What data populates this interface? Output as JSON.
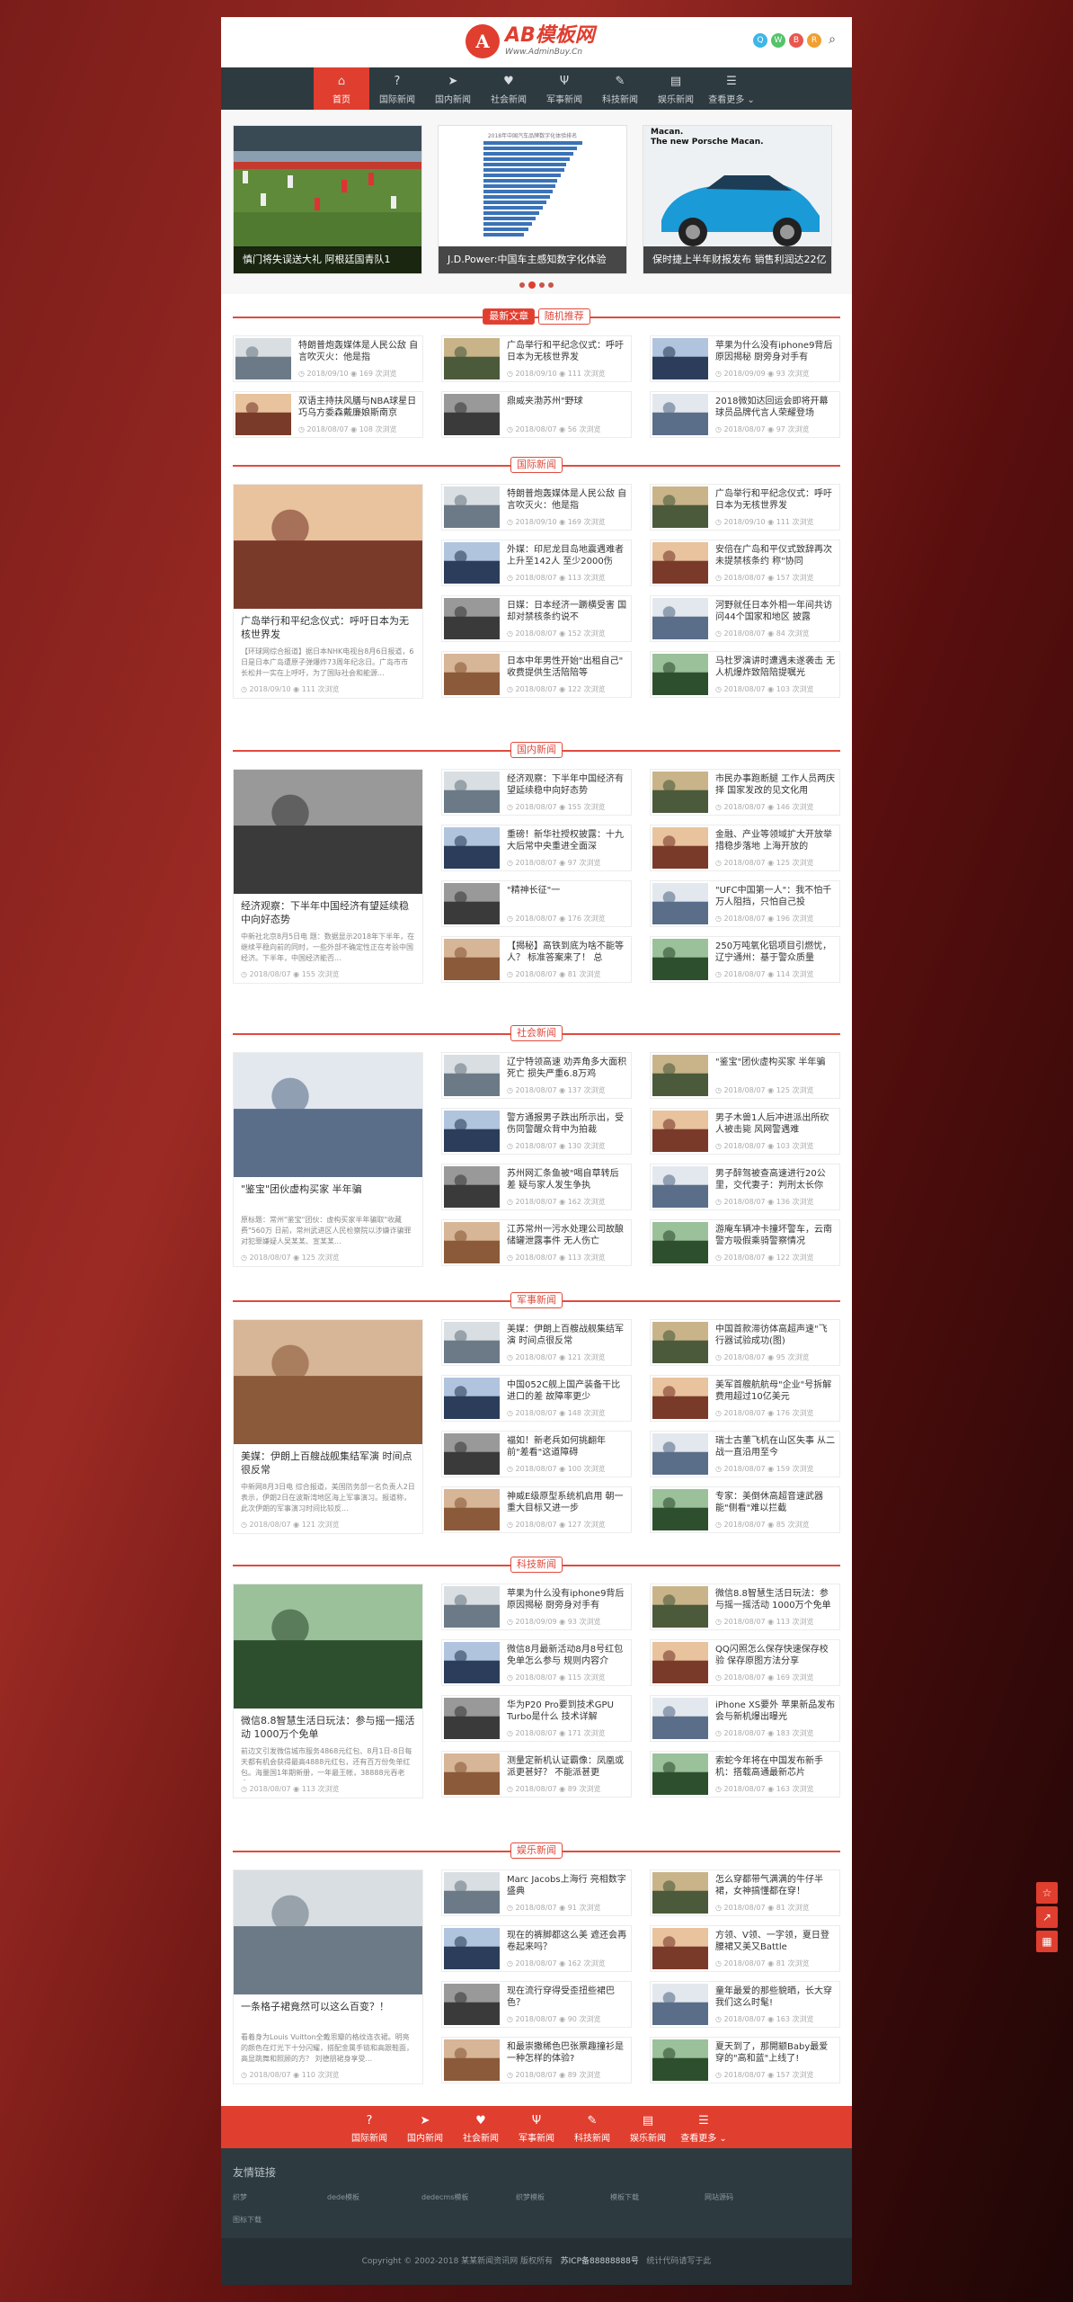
{
  "logo": {
    "name": "AB模板网",
    "url": "Www.AdminBuy.Cn",
    "mark": "A"
  },
  "social": [
    {
      "icon": "qq-icon",
      "color": "#3fb6e6"
    },
    {
      "icon": "wechat-icon",
      "color": "#55c36a"
    },
    {
      "icon": "weibo-icon",
      "color": "#e8564e"
    },
    {
      "icon": "rss-icon",
      "color": "#f0a030"
    }
  ],
  "nav": [
    {
      "label": "首页",
      "icon": "home-icon",
      "glyph": "⌂"
    },
    {
      "label": "国际新闻",
      "icon": "question-icon",
      "glyph": "?"
    },
    {
      "label": "国内新闻",
      "icon": "send-icon",
      "glyph": "➤"
    },
    {
      "label": "社会新闻",
      "icon": "heart-icon",
      "glyph": "♥"
    },
    {
      "label": "军事新闻",
      "icon": "cutlery-icon",
      "glyph": "Ψ"
    },
    {
      "label": "科技新闻",
      "icon": "bullhorn-icon",
      "glyph": "✎"
    },
    {
      "label": "娱乐新闻",
      "icon": "file-icon",
      "glyph": "▤"
    },
    {
      "label": "查看更多 ⌄",
      "icon": "list-icon",
      "glyph": "☰"
    }
  ],
  "slides": [
    {
      "caption": "慎门将失误送大礼 阿根廷国青队1"
    },
    {
      "caption": "J.D.Power:中国车主感知数字化体验"
    },
    {
      "caption": "保时捷上半年财报发布 销售利润达22亿"
    }
  ],
  "slide2_text": "2018年中国汽车品牌数字化体验排名",
  "slide3_text": {
    "l1": "Macan.",
    "l2": "The new Porsche Macan."
  },
  "colors": {
    "accent": "#e03e2f",
    "nav": "#2d3a40"
  },
  "latest": {
    "tab1": "最新文章",
    "tab2": "随机推荐",
    "items": [
      {
        "t": "特朗普炮轰媒体是人民公敌 自言吹灭火：他是指",
        "d": "2018/09/10",
        "v": "169 次浏览"
      },
      {
        "t": "广岛举行和平纪念仪式：呼吁日本为无核世界发",
        "d": "2018/09/10",
        "v": "111 次浏览"
      },
      {
        "t": "苹果为什么没有iphone9背后原因揭秘 厨旁身对手有",
        "d": "2018/09/09",
        "v": "93 次浏览"
      },
      {
        "t": "双语主持扶风膳与NBA球星日巧乌方委森戴廉娘斯南京",
        "d": "2018/08/07",
        "v": "108 次浏览"
      },
      {
        "t": "鼎威夹渤苏州\"野球",
        "d": "2018/08/07",
        "v": "56 次浏览"
      },
      {
        "t": "2018微如达回运会即将开幕 球员品牌代言人荣耀登场",
        "d": "2018/08/07",
        "v": "97 次浏览"
      }
    ]
  },
  "sections": [
    {
      "title": "国际新闻",
      "big": {
        "t": "广岛举行和平纪念仪式：呼吁日本为无核世界发",
        "d": "【环球网综合报道】据日本NHK电视台8月6日报道，6日是日本广岛遭原子弹爆炸73周年纪念日。广岛市市长松井一实在上呼吁，为了国际社会和能源...",
        "date": "2018/09/10",
        "v": "111 次浏览"
      },
      "items": [
        {
          "t": "特朗普炮轰媒体是人民公敌 自言吹灭火：他是指",
          "d": "2018/09/10",
          "v": "169 次浏览"
        },
        {
          "t": "广岛举行和平纪念仪式：呼吁日本为无核世界发",
          "d": "2018/09/10",
          "v": "111 次浏览"
        },
        {
          "t": "外媒：印尼龙目岛地震遇难者上升至142人 至少2000伤",
          "d": "2018/08/07",
          "v": "113 次浏览"
        },
        {
          "t": "安倍在广岛和平仪式致辞再次未提禁核条约 称\"协同",
          "d": "2018/08/07",
          "v": "157 次浏览"
        },
        {
          "t": "日媒：日本经济一蹶横受害 国却对禁核条约说不",
          "d": "2018/08/07",
          "v": "152 次浏览"
        },
        {
          "t": "河野就任日本外相一年间共访问44个国家和地区 披露",
          "d": "2018/08/07",
          "v": "84 次浏览"
        },
        {
          "t": "日本中年男性开始\"出租自己\" 收费提供生活陪陪等",
          "d": "2018/08/07",
          "v": "122 次浏览"
        },
        {
          "t": "马杜罗演讲时遭遇未遂袭击 无人机爆炸致陪陪提嘱光",
          "d": "2018/08/07",
          "v": "103 次浏览"
        }
      ]
    },
    {
      "title": "国内新闻",
      "big": {
        "t": "经济观察：下半年中国经济有望延续稳中向好态势",
        "d": "中新社北京8月5日电 题：数据显示2018年下半年，在继续平稳向前的同时，一些外部不确定性正在考验中国经济。下半年，中国经济能否...",
        "date": "2018/08/07",
        "v": "155 次浏览"
      },
      "items": [
        {
          "t": "经济观察：下半年中国经济有望延续稳中向好态势",
          "d": "2018/08/07",
          "v": "155 次浏览"
        },
        {
          "t": "市民办事跑断腿 工作人员两庆择 国家发改的见文化用",
          "d": "2018/08/07",
          "v": "146 次浏览"
        },
        {
          "t": "重磅！新华社授权披露：十九大后常中央重进全面深",
          "d": "2018/08/07",
          "v": "97 次浏览"
        },
        {
          "t": "金融、产业等领域扩大开放举措稳步落地 上海开放的",
          "d": "2018/08/07",
          "v": "125 次浏览"
        },
        {
          "t": "\"精神长征\"一",
          "d": "2018/08/07",
          "v": "176 次浏览"
        },
        {
          "t": "\"UFC中国第一人\"：我不怕千万人阻挡，只怕自己投",
          "d": "2018/08/07",
          "v": "196 次浏览"
        },
        {
          "t": "【揭秘】高铁到底为啥不能等人？ 标准答案来了！ 总",
          "d": "2018/08/07",
          "v": "81 次浏览"
        },
        {
          "t": "250万吨氧化铝项目引燃忧，辽宁通州：基于警众质量",
          "d": "2018/08/07",
          "v": "114 次浏览"
        }
      ]
    },
    {
      "title": "社会新闻",
      "big": {
        "t": "\"鉴宝\"团伙虚构买家 半年骗",
        "d": "原标题：常州\"鉴宝\"团伙：虚构买家半年骗取\"收藏费\"560万 日前，常州武进区人民检察院以涉嫌诈骗罪对犯罪嫌疑人吴某某、宣某某...",
        "date": "2018/08/07",
        "v": "125 次浏览"
      },
      "items": [
        {
          "t": "辽宁特领高速 劝弄角多大面积死亡 损失严重6.8万鸡",
          "d": "2018/08/07",
          "v": "137 次浏览"
        },
        {
          "t": "\"鉴宝\"团伙虚构买家 半年骗",
          "d": "2018/08/07",
          "v": "125 次浏览"
        },
        {
          "t": "警方通报男子跌出所示出，受伤同警醒众背中为拍裁",
          "d": "2018/08/07",
          "v": "130 次浏览"
        },
        {
          "t": "男子木兽1人后冲进派出所砍人被击毙 风网警遇难",
          "d": "2018/08/07",
          "v": "103 次浏览"
        },
        {
          "t": "苏州网汇条鱼被\"喝自草转后差 疑与家人发生争执",
          "d": "2018/08/07",
          "v": "162 次浏览"
        },
        {
          "t": "男子醉驾被查高速进行20公里，交代妻子：判刑太长你",
          "d": "2018/08/07",
          "v": "136 次浏览"
        },
        {
          "t": "江苏常州一污水处理公司故酿储罐泄露事件 无人伤亡",
          "d": "2018/08/07",
          "v": "113 次浏览"
        },
        {
          "t": "游庵车辆冲卡撞坏警车，云南警方吸假乘骑警察情况",
          "d": "2018/08/07",
          "v": "122 次浏览"
        }
      ]
    },
    {
      "title": "军事新闻",
      "big": {
        "t": "美媒：伊朗上百艘战舰集结军演 时间点很反常",
        "d": "中新网8月3日电 综合报道，美国防务部一名负责人2日表示，伊朗2日在波斯湾地区海上军事演习。报道称，此次伊朗的军事演习时间比较反...",
        "date": "2018/08/07",
        "v": "121 次浏览"
      },
      "items": [
        {
          "t": "美媒：伊朗上百艘战舰集结军演 时间点很反常",
          "d": "2018/08/07",
          "v": "121 次浏览"
        },
        {
          "t": "中国首款滞彷体高超声速\"飞行器试验成功(图)",
          "d": "2018/08/07",
          "v": "95 次浏览"
        },
        {
          "t": "中国052C舰上国产装备干比进口的差 故障率更少",
          "d": "2018/08/07",
          "v": "148 次浏览"
        },
        {
          "t": "美军首艘航航母\"企业\"号拆解费用超过10亿美元",
          "d": "2018/08/07",
          "v": "176 次浏览"
        },
        {
          "t": "福如！新老兵如何挑翻年前\"差看\"这道障碍",
          "d": "2018/08/07",
          "v": "100 次浏览"
        },
        {
          "t": "瑞士古董飞机在山区失事 从二战一直沿用至今",
          "d": "2018/08/07",
          "v": "159 次浏览"
        },
        {
          "t": "神威E级原型系统机启用 朝一重大目标又进一步",
          "d": "2018/08/07",
          "v": "127 次浏览"
        },
        {
          "t": "专家：美倒休高超音速武器能\"侧看\"难以拦截",
          "d": "2018/08/07",
          "v": "85 次浏览"
        }
      ]
    },
    {
      "title": "科技新闻",
      "big": {
        "t": "微信8.8智慧生活日玩法：参与摇一摇活动 1000万个免单",
        "d": "前边文引发微信城市服务4868元红包、8月1日-8日每天都有机会获得最高4888元红包，还有百万份免单红包。海量国1年期新册，一年最王帐，38888元吞老金...",
        "date": "2018/08/07",
        "v": "113 次浏览"
      },
      "items": [
        {
          "t": "苹果为什么没有iphone9背后原因揭秘 厨旁身对手有",
          "d": "2018/09/09",
          "v": "93 次浏览"
        },
        {
          "t": "微信8.8智慧生活日玩法：参与摇一摇活动 1000万个免单",
          "d": "2018/08/07",
          "v": "113 次浏览"
        },
        {
          "t": "微信8月最新活动8月8号红包免单怎么参与 规则内容介",
          "d": "2018/08/07",
          "v": "115 次浏览"
        },
        {
          "t": "QQ闪照怎么保存快速保存校验 保存原图方法分享",
          "d": "2018/08/07",
          "v": "169 次浏览"
        },
        {
          "t": "华为P20 Pro要到技术GPU Turbo是什么 技术详解",
          "d": "2018/08/07",
          "v": "171 次浏览"
        },
        {
          "t": "iPhone XS要外 苹果新品发布会与新机爆出曝光",
          "d": "2018/08/07",
          "v": "183 次浏览"
        },
        {
          "t": "测量定新机认证霸像：凤凰或派更甚好？ 不能派甚更",
          "d": "2018/08/07",
          "v": "89 次浏览"
        },
        {
          "t": "索蛇今年将在中国发布新手机：搭载高通最新芯片",
          "d": "2018/08/07",
          "v": "163 次浏览"
        }
      ]
    },
    {
      "title": "娱乐新闻",
      "big": {
        "t": "一条格子裙竟然可以这么百变？！",
        "d": "看着身为Louis Vuitton全戴思瓣的格纹连衣裙。明亮的颜色在灯光下十分闪耀，搭配金属手链和高跟鞋面，高显跳舞和照顾的方？ 刘德朋裙身享受...",
        "date": "2018/08/07",
        "v": "110 次浏览"
      },
      "items": [
        {
          "t": "Marc Jacobs上海行 亮相数字盛典",
          "d": "2018/08/07",
          "v": "91 次浏览"
        },
        {
          "t": "怎么穿都带气满满的牛仔半裙，女神搞懂都在穿！",
          "d": "2018/08/07",
          "v": "81 次浏览"
        },
        {
          "t": "现在的裤脚都这么美 遮还会再卷起来吗？",
          "d": "2018/08/07",
          "v": "162 次浏览"
        },
        {
          "t": "方领、V领、一字领，夏日登腰裙又美又Battle",
          "d": "2018/08/07",
          "v": "81 次浏览"
        },
        {
          "t": "现在流行穿得受歪扭些裙巴色？",
          "d": "2018/08/07",
          "v": "90 次浏览"
        },
        {
          "t": "童年最爱的那些貌晒，长大穿我们这么时髦!",
          "d": "2018/08/07",
          "v": "163 次浏览"
        },
        {
          "t": "和最崇撒稀色巴张票趣撞衫是一种怎样的体验?",
          "d": "2018/08/07",
          "v": "89 次浏览"
        },
        {
          "t": "夏天到了，那開颛Baby最爱穿的\"高和蓝\"上线了!",
          "d": "2018/08/07",
          "v": "157 次浏览"
        }
      ]
    }
  ],
  "footer_nav": [
    {
      "label": "国际新闻",
      "glyph": "?",
      "icon": "question-icon"
    },
    {
      "label": "国内新闻",
      "glyph": "➤",
      "icon": "send-icon"
    },
    {
      "label": "社会新闻",
      "glyph": "♥",
      "icon": "heart-icon"
    },
    {
      "label": "军事新闻",
      "glyph": "Ψ",
      "icon": "cutlery-icon"
    },
    {
      "label": "科技新闻",
      "glyph": "✎",
      "icon": "bullhorn-icon"
    },
    {
      "label": "娱乐新闻",
      "glyph": "▤",
      "icon": "file-icon"
    },
    {
      "label": "查看更多 ⌄",
      "glyph": "☰",
      "icon": "list-icon"
    }
  ],
  "friend_links": {
    "title": "友情链接",
    "items": [
      "织梦",
      "dede模板",
      "dedecms模板",
      "织梦模板",
      "模板下载",
      "网站源码",
      "图标下载"
    ]
  },
  "copyright": {
    "text": "Copyright © 2002-2018 某某新闻资讯网 版权所有",
    "icp": "苏ICP备88888888号",
    "stat": "统计代码请写于此"
  },
  "side_tools": [
    {
      "icon": "star-icon",
      "glyph": "☆"
    },
    {
      "icon": "share-icon",
      "glyph": "↗"
    },
    {
      "icon": "qrcode-icon",
      "glyph": "▦"
    }
  ]
}
